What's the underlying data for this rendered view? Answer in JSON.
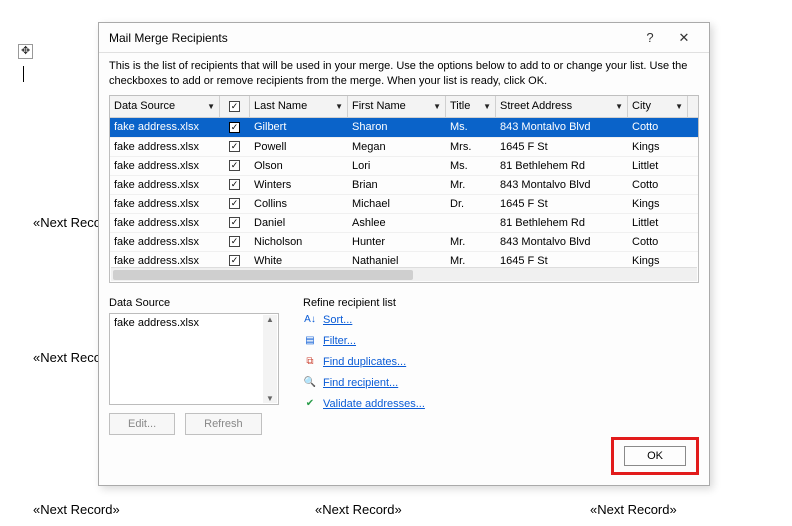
{
  "background_fields": {
    "f1": "«Next Reco",
    "f2": "«Next Reco",
    "f3": "«Next Record»",
    "f4": "«Next Record»",
    "f5": "«Next Record»"
  },
  "dialog": {
    "title": "Mail Merge Recipients",
    "intro": "This is the list of recipients that will be used in your merge.  Use the options below to add to or change your list. Use the checkboxes to add or remove recipients from the merge.  When your list is ready, click OK.",
    "columns": {
      "data_source": "Data Source",
      "last_name": "Last Name",
      "first_name": "First Name",
      "title": "Title",
      "street_address": "Street Address",
      "city": "City"
    },
    "rows": [
      {
        "ds": "fake address.xlsx",
        "checked": true,
        "selected": true,
        "ln": "Gilbert",
        "fn": "Sharon",
        "tl": "Ms.",
        "sa": "843 Montalvo Blvd",
        "ct": "Cotto"
      },
      {
        "ds": "fake address.xlsx",
        "checked": true,
        "selected": false,
        "ln": "Powell",
        "fn": "Megan",
        "tl": "Mrs.",
        "sa": "1645 F St",
        "ct": "Kings"
      },
      {
        "ds": "fake address.xlsx",
        "checked": true,
        "selected": false,
        "ln": "Olson",
        "fn": "Lori",
        "tl": "Ms.",
        "sa": "81 Bethlehem Rd",
        "ct": "Littlet"
      },
      {
        "ds": "fake address.xlsx",
        "checked": true,
        "selected": false,
        "ln": "Winters",
        "fn": "Brian",
        "tl": "Mr.",
        "sa": "843 Montalvo Blvd",
        "ct": "Cotto"
      },
      {
        "ds": "fake address.xlsx",
        "checked": true,
        "selected": false,
        "ln": "Collins",
        "fn": "Michael",
        "tl": "Dr.",
        "sa": "1645 F St",
        "ct": "Kings"
      },
      {
        "ds": "fake address.xlsx",
        "checked": true,
        "selected": false,
        "ln": "Daniel",
        "fn": "Ashlee",
        "tl": "",
        "sa": "81 Bethlehem Rd",
        "ct": "Littlet"
      },
      {
        "ds": "fake address.xlsx",
        "checked": true,
        "selected": false,
        "ln": "Nicholson",
        "fn": "Hunter",
        "tl": "Mr.",
        "sa": "843 Montalvo Blvd",
        "ct": "Cotto"
      },
      {
        "ds": "fake address.xlsx",
        "checked": true,
        "selected": false,
        "ln": "White",
        "fn": "Nathaniel",
        "tl": "Mr.",
        "sa": "1645 F St",
        "ct": "Kings"
      }
    ],
    "data_source_panel": {
      "label": "Data Source",
      "item": "fake address.xlsx",
      "edit": "Edit...",
      "refresh": "Refresh"
    },
    "refine": {
      "label": "Refine recipient list",
      "sort": "Sort...",
      "filter": "Filter...",
      "duplicates": "Find duplicates...",
      "find": "Find recipient...",
      "validate": "Validate addresses..."
    },
    "ok": "OK"
  }
}
